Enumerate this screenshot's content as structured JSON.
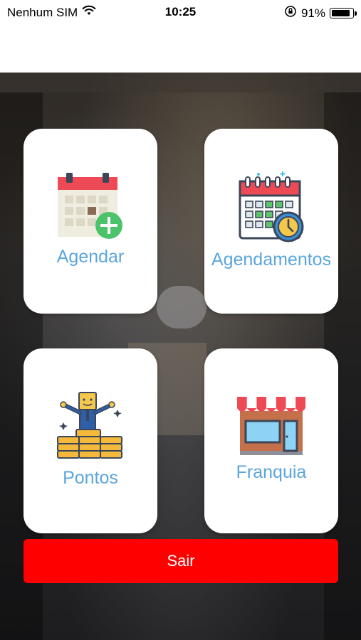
{
  "status_bar": {
    "carrier": "Nenhum SIM",
    "time": "10:25",
    "battery_percent": "91%",
    "battery_level": 0.91,
    "icons": [
      "wifi-icon",
      "orientation-lock-icon",
      "battery-icon"
    ]
  },
  "menu": {
    "schedule_label": "Agendar",
    "appointments_label": "Agendamentos",
    "points_label": "Pontos",
    "franchise_label": "Franquia",
    "logout_label": "Sair"
  },
  "colors": {
    "label": "#5aa6dc",
    "logout": "#ff0000",
    "tile": "#ffffff"
  }
}
